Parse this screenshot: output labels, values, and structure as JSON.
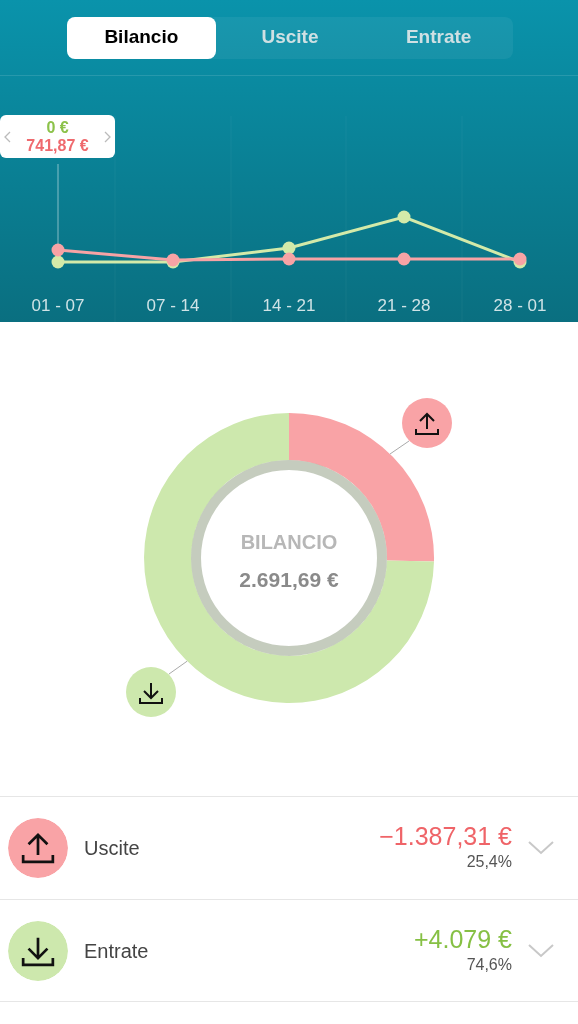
{
  "tabs": [
    {
      "label": "Bilancio",
      "selected": true
    },
    {
      "label": "Uscite",
      "selected": false
    },
    {
      "label": "Entrate",
      "selected": false
    }
  ],
  "trend": {
    "x_labels": [
      "01 - 07",
      "07 - 14",
      "14 - 21",
      "21 - 28",
      "28 - 01"
    ],
    "tooltip": {
      "income": "0 €",
      "expense": "741,87 €"
    }
  },
  "summary": {
    "title": "BILANCIO",
    "amount": "2.691,69 €",
    "chart_data": {
      "type": "donut",
      "values": [
        25.4,
        74.6
      ]
    }
  },
  "rows": [
    {
      "kind": "expense",
      "label": "Uscite",
      "amount": "−1.387,31 €",
      "percent": "25,4%"
    },
    {
      "kind": "income",
      "label": "Entrate",
      "amount": "+4.079 €",
      "percent": "74,6%"
    }
  ]
}
